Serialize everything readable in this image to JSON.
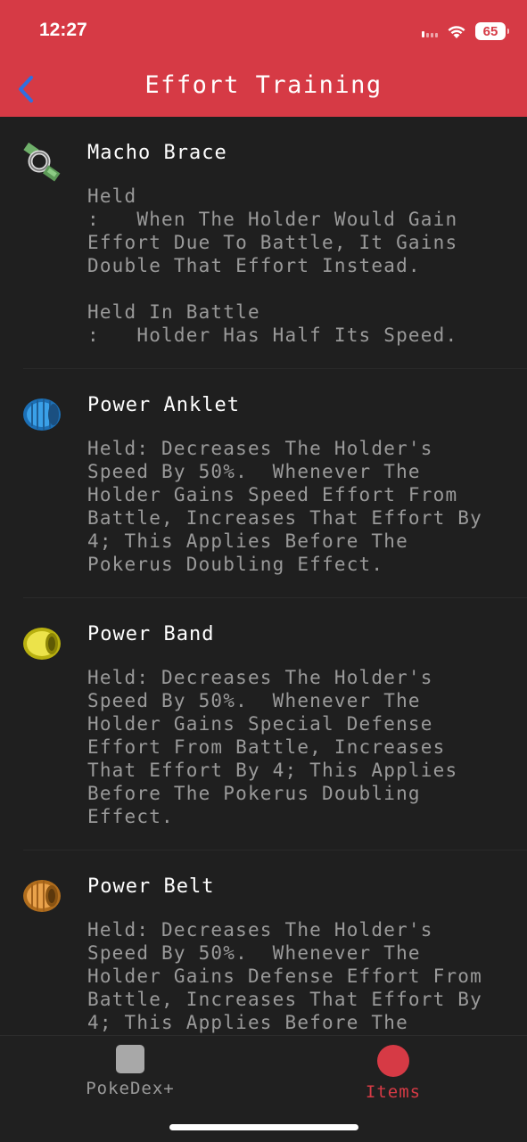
{
  "status_bar": {
    "time": "12:27",
    "battery": "65",
    "icons": [
      "signal-icon",
      "wifi-icon",
      "battery-icon"
    ]
  },
  "nav": {
    "title": "Effort Training",
    "back_icon": "chevron-left-icon"
  },
  "items": [
    {
      "name": "Macho Brace",
      "icon": "macho-brace-icon",
      "descriptions": [
        "Held\n:   When The Holder Would Gain\nEffort Due To Battle, It Gains\nDouble That Effort Instead.",
        "Held In Battle\n:   Holder Has Half Its Speed."
      ]
    },
    {
      "name": "Power Anklet",
      "icon": "power-anklet-icon",
      "descriptions": [
        "Held: Decreases The Holder's\nSpeed By 50%.  Whenever The\nHolder Gains Speed Effort From\nBattle, Increases That Effort By\n4; This Applies Before The\nPokerus Doubling Effect."
      ]
    },
    {
      "name": "Power Band",
      "icon": "power-band-icon",
      "descriptions": [
        "Held: Decreases The Holder's\nSpeed By 50%.  Whenever The\nHolder Gains Special Defense\nEffort From Battle, Increases\nThat Effort By 4; This Applies\nBefore The Pokerus Doubling\nEffect."
      ]
    },
    {
      "name": "Power Belt",
      "icon": "power-belt-icon",
      "descriptions": [
        "Held: Decreases The Holder's\nSpeed By 50%.  Whenever The\nHolder Gains Defense Effort From\nBattle, Increases That Effort By\n4; This Applies Before The\nPokerus Doubling Effect."
      ]
    }
  ],
  "tabbar": {
    "tabs": [
      {
        "label": "PokeDex+",
        "icon": "pokedex-tab-icon"
      },
      {
        "label": "Items",
        "icon": "items-tab-icon"
      }
    ]
  },
  "colors": {
    "accent": "#d63a45",
    "background": "#1f1f1f",
    "text": "#9a9a9a",
    "title": "#ffffff"
  }
}
